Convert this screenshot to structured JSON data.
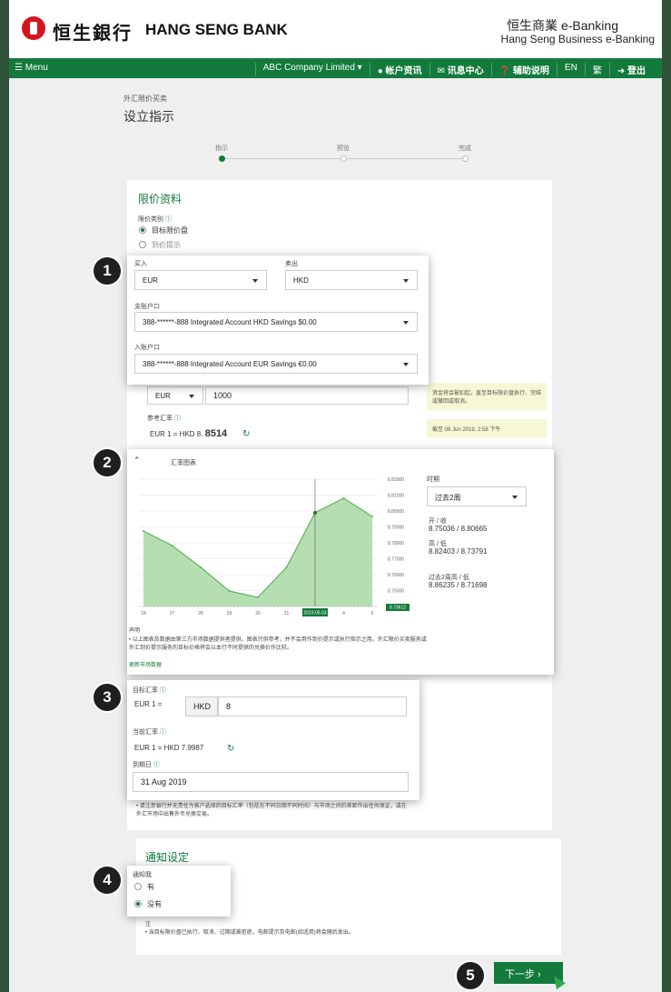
{
  "header": {
    "logo_cn": "恒生銀行",
    "logo_en": "HANG SENG BANK",
    "ebanking_cn": "恒生商業 e-Banking",
    "ebanking_en": "Hang Seng Business e-Banking"
  },
  "nav": {
    "menu": "☰ Menu",
    "company": "ABC Company Limited ▾",
    "account_info": "帐户资讯",
    "message_center": "讯息中心",
    "help": "辅助说明",
    "lang_en": "EN",
    "lang_tc": "繁",
    "logout": "登出"
  },
  "page": {
    "breadcrumb": "外汇限价买卖",
    "title": "设立指示"
  },
  "steps": [
    "指示",
    "预览",
    "完成"
  ],
  "limit_info": {
    "section_title": "限价资料",
    "order_type_label": "限价类别",
    "option_target": "目标限价盘",
    "option_alert": "到价提示",
    "buy_label": "买入",
    "buy_value": "EUR",
    "sell_label": "卖出",
    "sell_value": "HKD",
    "debit_label": "支账户口",
    "debit_account": "388-******-888 Integrated Account HKD Savings $0.00",
    "credit_label": "入账户口",
    "credit_account": "388-******-888 Integrated Account EUR Savings €0.00",
    "amount_ccy": "EUR",
    "amount_value": "1000",
    "ref_rate_label": "参考汇率",
    "ref_rate_prefix": "EUR 1 = HKD 8.",
    "ref_rate_value": "8514",
    "note1": "资金将会被扣起，直至目标限价盘执行、完结或撤回或取消。",
    "note2": "截至 06 Jun 2019, 2:58 下午"
  },
  "chart": {
    "toggle_label": "汇率图表",
    "period_label": "时期",
    "period_value": "过去2周",
    "open_close_label": "开 / 收",
    "open_close_value": "8.75036 / 8.80665",
    "high_low_label": "高 / 低",
    "high_low_value": "8.82403 / 8.73791",
    "range_label": "过去2周高 / 低",
    "range_value": "8.86235 / 8.71698",
    "x_labels": [
      "24",
      "27",
      "28",
      "29",
      "30",
      "31",
      "2019.06.03",
      "4",
      "5"
    ],
    "y_labels": [
      "8.82000",
      "8.81000",
      "8.80000",
      "8.79000",
      "8.78000",
      "8.77000",
      "8.76000",
      "8.75000",
      "8.74000"
    ],
    "marker_value": "8.73612",
    "disclaimer_title": "声明",
    "disclaimer_text": "• 以上图表及数据由第三方市场数据提供者提供。图表只供参考，并不会用作到价提示或执行指示之用。外汇限价买卖服务或外汇到价提示服务的目标价格将会以本行不时提供的兑换价作比较。",
    "more_link": "更新市场数据"
  },
  "chart_data": {
    "type": "area",
    "title": "",
    "xlabel": "",
    "ylabel": "",
    "categories": [
      "24",
      "27",
      "28",
      "29",
      "30",
      "31",
      "2019.06.03",
      "4",
      "5"
    ],
    "values": [
      8.796,
      8.788,
      8.776,
      8.763,
      8.7595,
      8.776,
      8.806,
      8.814,
      8.804
    ],
    "ylim": [
      8.7545,
      8.8245
    ],
    "grid": true,
    "colors": {
      "fill": "#b5dfb2",
      "stroke": "#5bb35c"
    }
  },
  "target": {
    "target_rate_label": "目标汇率",
    "rate_prefix": "EUR 1 =",
    "rate_ccy": "HKD",
    "rate_value": "8",
    "current_rate_label": "当前汇率",
    "current_rate_value": "EUR 1 = HKD 7.9987",
    "expiry_label": "到期日",
    "expiry_value": "31 Aug 2019",
    "note_text": "• 请注意银行并无责任为客户选择的目标汇率（包括在不同日期不同时间）与市场之间的差距作出任何保证，或在外汇市场中出售外币兑换交易。"
  },
  "notify": {
    "section_title": "通知设定",
    "notify_label": "通知我",
    "option_yes": "有",
    "option_no": "没有",
    "remark_title": "注",
    "remark_text": "• 当目标限价盘已执行、取消、过期或被拒绝，电邮提示及电邮(如适用)将会随后发出。"
  },
  "actions": {
    "next": "下一步  ›"
  },
  "badges": [
    "1",
    "2",
    "3",
    "4",
    "5"
  ]
}
